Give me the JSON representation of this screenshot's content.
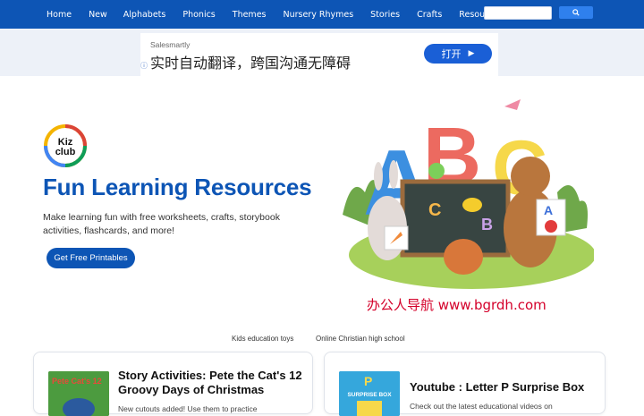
{
  "nav": {
    "items": [
      {
        "label": "Home"
      },
      {
        "label": "New"
      },
      {
        "label": "Alphabets"
      },
      {
        "label": "Phonics"
      },
      {
        "label": "Themes"
      },
      {
        "label": "Nursery Rhymes"
      },
      {
        "label": "Stories"
      },
      {
        "label": "Crafts"
      },
      {
        "label": "Resources"
      }
    ],
    "search_value": ""
  },
  "ad": {
    "brand": "Salesmartly",
    "text": "实时自动翻译，跨国沟通无障碍",
    "button_label": "打开"
  },
  "hero": {
    "logo_text_1": "Kiz",
    "logo_text_2": "club",
    "title": "Fun Learning Resources",
    "description": "Make learning fun with free worksheets, crafts, storybook activities, flashcards, and more!",
    "cta_label": "Get Free Printables",
    "art_letters": [
      "A",
      "B",
      "C"
    ]
  },
  "watermark": "办公人导航  www.bgrdh.com",
  "links": [
    "Kids education toys",
    "Online Christian high school"
  ],
  "cards": [
    {
      "title": "Story Activities: Pete the Cat's 12 Groovy Days of Christmas",
      "text": "New cutouts added! Use them to practice",
      "thumb_text": "Pete Cat's 12"
    },
    {
      "title": "Youtube : Letter P Surprise Box",
      "text": "Check out the latest educational videos on",
      "thumb_text": "SURPRISE BOX",
      "thumb_letter": "P"
    }
  ],
  "colors": {
    "nav_bg": "#0d55b5",
    "accent": "#0d55b5",
    "ad_button": "#1a5fd6"
  }
}
